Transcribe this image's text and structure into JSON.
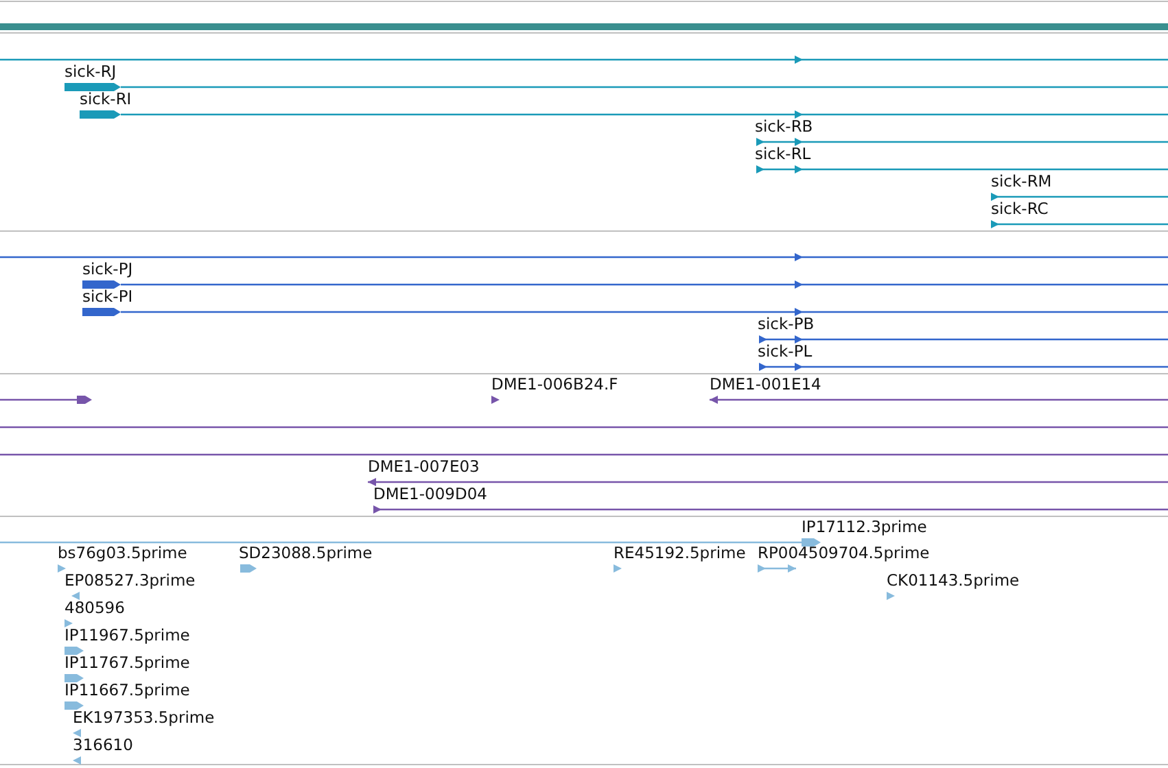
{
  "tracks": [
    {
      "features": [
        {
          "kind": "forward"
        },
        {
          "label": "sick-RJ",
          "kind": "forward"
        },
        {
          "label": "sick-RI",
          "kind": "forward"
        },
        {
          "label": "sick-RB",
          "kind": "forward"
        },
        {
          "label": "sick-RL",
          "kind": "forward"
        },
        {
          "label": "sick-RM",
          "kind": "forward"
        },
        {
          "label": "sick-RC",
          "kind": "forward"
        }
      ]
    },
    {
      "features": [
        {
          "kind": "forward"
        },
        {
          "label": "sick-PJ",
          "kind": "forward"
        },
        {
          "label": "sick-PI",
          "kind": "forward"
        },
        {
          "label": "sick-PB",
          "kind": "forward"
        },
        {
          "label": "sick-PL",
          "kind": "forward"
        }
      ]
    },
    {
      "features": [
        {
          "kind": "forward"
        },
        {
          "label": "DME1-006B24.F",
          "kind": "forward"
        },
        {
          "label": "DME1-001E14",
          "kind": "reverse"
        },
        {
          "kind": "forward"
        },
        {
          "kind": "forward"
        },
        {
          "label": "DME1-007E03",
          "kind": "reverse"
        },
        {
          "label": "DME1-009D04",
          "kind": "forward"
        }
      ]
    },
    {
      "features": [
        {
          "label": "IP17112.3prime",
          "kind": "forward"
        },
        {
          "label": "bs76g03.5prime",
          "kind": "forward"
        },
        {
          "label": "SD23088.5prime",
          "kind": "forward"
        },
        {
          "label": "RE45192.5prime",
          "kind": "forward"
        },
        {
          "label": "RP004509704.5prime",
          "kind": "forward"
        },
        {
          "label": "EP08527.3prime",
          "kind": "reverse"
        },
        {
          "label": "CK01143.5prime",
          "kind": "forward"
        },
        {
          "label": "480596",
          "kind": "forward"
        },
        {
          "label": "IP11967.5prime",
          "kind": "forward"
        },
        {
          "label": "IP11767.5prime",
          "kind": "forward"
        },
        {
          "label": "IP11667.5prime",
          "kind": "forward"
        },
        {
          "label": "EK197353.5prime",
          "kind": "reverse"
        },
        {
          "label": "316610",
          "kind": "reverse"
        }
      ]
    }
  ]
}
